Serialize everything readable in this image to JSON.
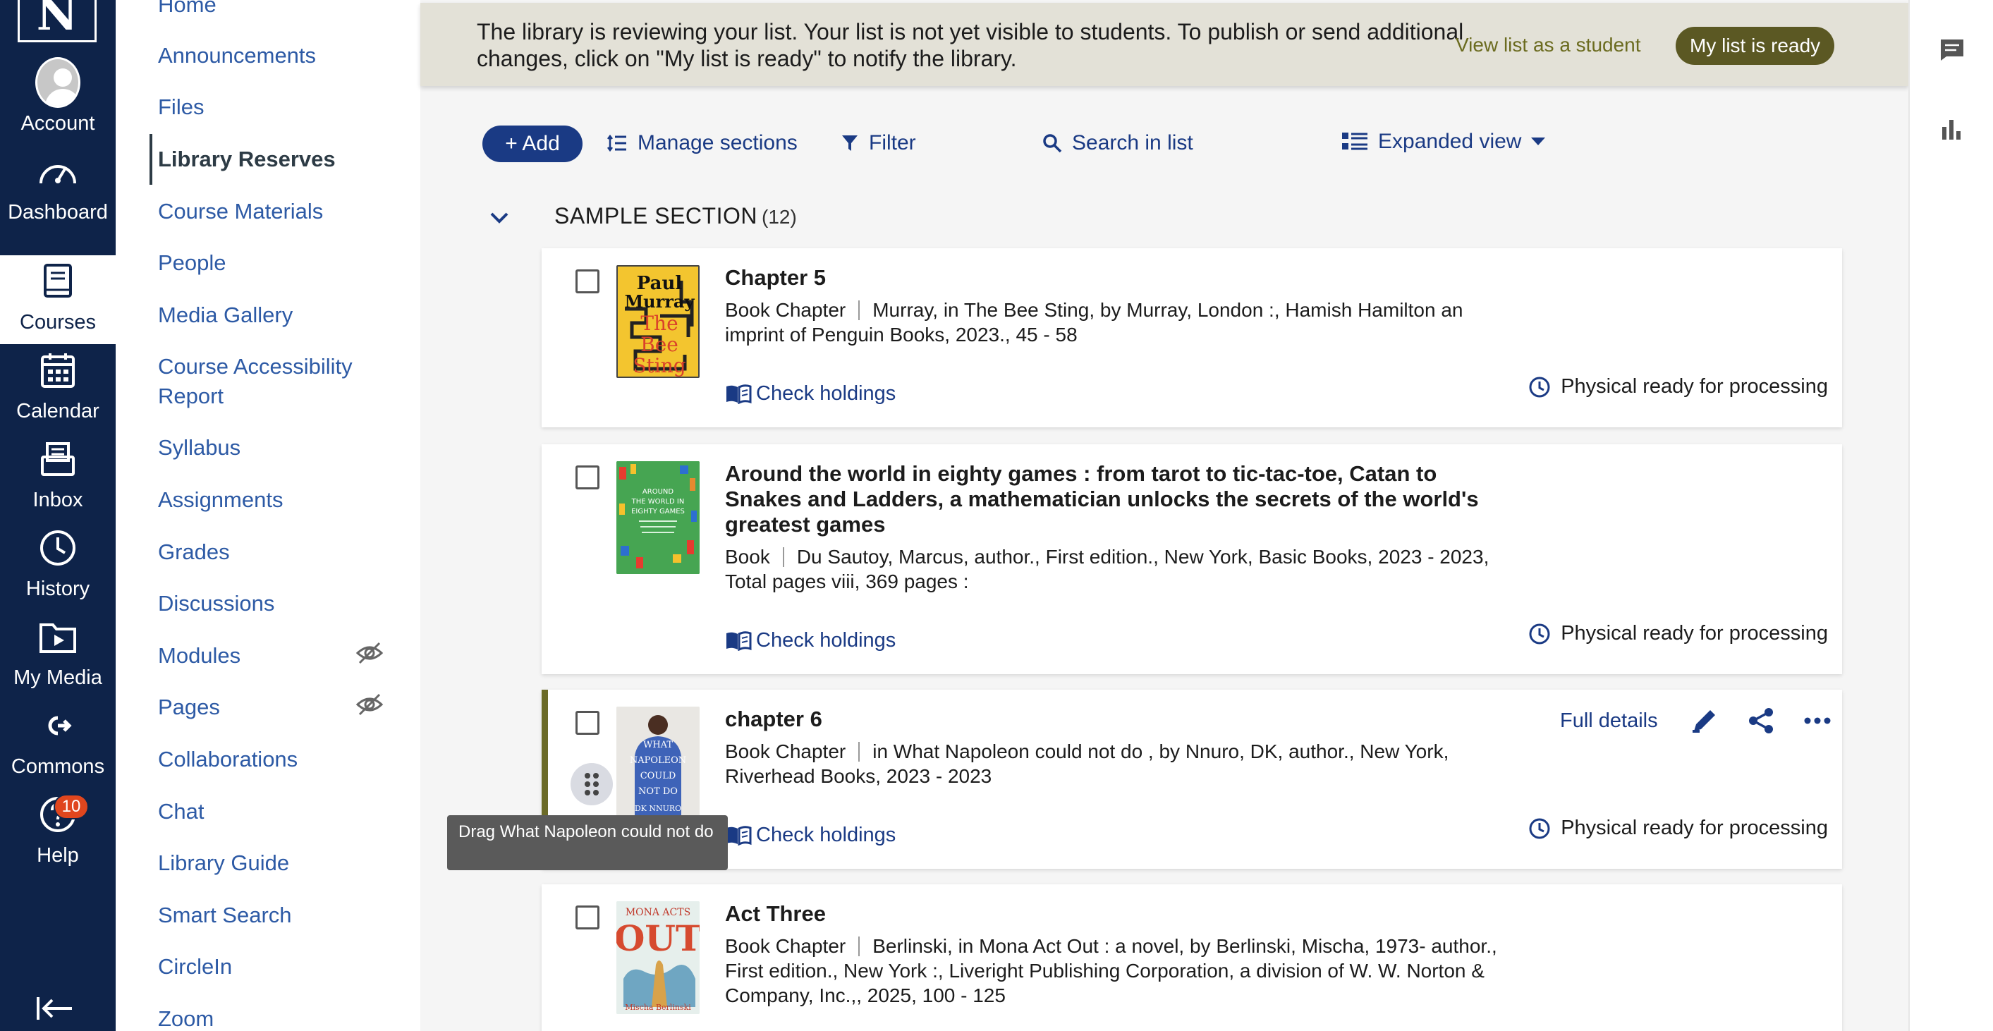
{
  "global_nav": {
    "items": [
      {
        "label": "Account",
        "icon": "account-avatar-icon"
      },
      {
        "label": "Dashboard",
        "icon": "dashboard-gauge-icon"
      },
      {
        "label": "Courses",
        "icon": "courses-book-icon",
        "active": true
      },
      {
        "label": "Calendar",
        "icon": "calendar-icon"
      },
      {
        "label": "Inbox",
        "icon": "inbox-icon"
      },
      {
        "label": "History",
        "icon": "history-clock-icon"
      },
      {
        "label": "My Media",
        "icon": "media-folder-icon"
      },
      {
        "label": "Commons",
        "icon": "commons-icon"
      },
      {
        "label": "Help",
        "icon": "help-icon",
        "badge": "10"
      }
    ],
    "logo_letter": "N"
  },
  "course_nav": {
    "items": [
      {
        "label": "Home"
      },
      {
        "label": "Announcements"
      },
      {
        "label": "Files"
      },
      {
        "label": "Library Reserves",
        "active": true
      },
      {
        "label": "Course Materials"
      },
      {
        "label": "People"
      },
      {
        "label": "Media Gallery"
      },
      {
        "label": "Course Accessibility Report"
      },
      {
        "label": "Syllabus"
      },
      {
        "label": "Assignments"
      },
      {
        "label": "Grades"
      },
      {
        "label": "Discussions"
      },
      {
        "label": "Modules",
        "hidden_icon": true
      },
      {
        "label": "Pages",
        "hidden_icon": true
      },
      {
        "label": "Collaborations"
      },
      {
        "label": "Chat"
      },
      {
        "label": "Library Guide"
      },
      {
        "label": "Smart Search"
      },
      {
        "label": "CircleIn"
      },
      {
        "label": "Zoom"
      }
    ]
  },
  "banner": {
    "message": "The library is reviewing your list. Your list is not yet visible to students. To publish or send additional changes, click on \"My list is ready\" to notify the library.",
    "view_as_student": "View list as a student",
    "ready_button": "My list is ready",
    "bg_color": "#e3e1d7",
    "button_color": "#5b5823"
  },
  "toolbar": {
    "add_label": "+ Add",
    "manage_sections": "Manage sections",
    "filter": "Filter",
    "search": "Search in list",
    "view_mode": "Expanded view"
  },
  "section": {
    "title": "SAMPLE SECTION",
    "count": "(12)"
  },
  "items": [
    {
      "title": "Chapter 5",
      "type": "Book Chapter",
      "citation": "Murray, in The Bee Sting, by Murray, London :, Hamish Hamilton an imprint of Penguin Books, 2023., 45 - 58",
      "holdings": "Check holdings",
      "status": "Physical ready for processing",
      "cover": {
        "line1": "Paul",
        "line2": "Murray",
        "line3": "The",
        "line4": "Bee",
        "line5": "Sting"
      }
    },
    {
      "title": "Around the world in eighty games : from tarot to tic-tac-toe, Catan to Snakes and Ladders, a mathematician unlocks the secrets of the world's greatest games",
      "type": "Book",
      "citation": "Du Sautoy, Marcus, author., First edition., New York, Basic Books, 2023 - 2023, Total pages viii, 369 pages :",
      "holdings": "Check holdings",
      "status": "Physical ready for processing",
      "cover": {
        "line1": "AROUND",
        "line2": "THE WORLD IN",
        "line3": "EIGHTY GAMES"
      }
    },
    {
      "title": "chapter 6",
      "type": "Book Chapter",
      "citation": "in What Napoleon could not do , by Nnuro, DK, author., New York, Riverhead Books, 2023 - 2023",
      "holdings": "Check holdings",
      "status": "Physical ready for processing",
      "full_details": "Full details",
      "cover": {
        "line1": "WHAT",
        "line2": "NAPOLEON",
        "line3": "COULD",
        "line4": "NOT DO",
        "line5": "DK NNURO"
      },
      "tooltip": "Drag What Napoleon could not do"
    },
    {
      "title": "Act Three",
      "type": "Book Chapter",
      "citation": "Berlinski, in Mona Act Out : a novel, by Berlinski, Mischa, 1973- author., First edition., New York :, Liveright Publishing Corporation, a division of W. W. Norton & Company, Inc.,, 2025, 100 - 125",
      "cover": {
        "line1": "MONA ACTS",
        "line2": "OUT",
        "line3": "Mischa Berlinski"
      }
    }
  ]
}
